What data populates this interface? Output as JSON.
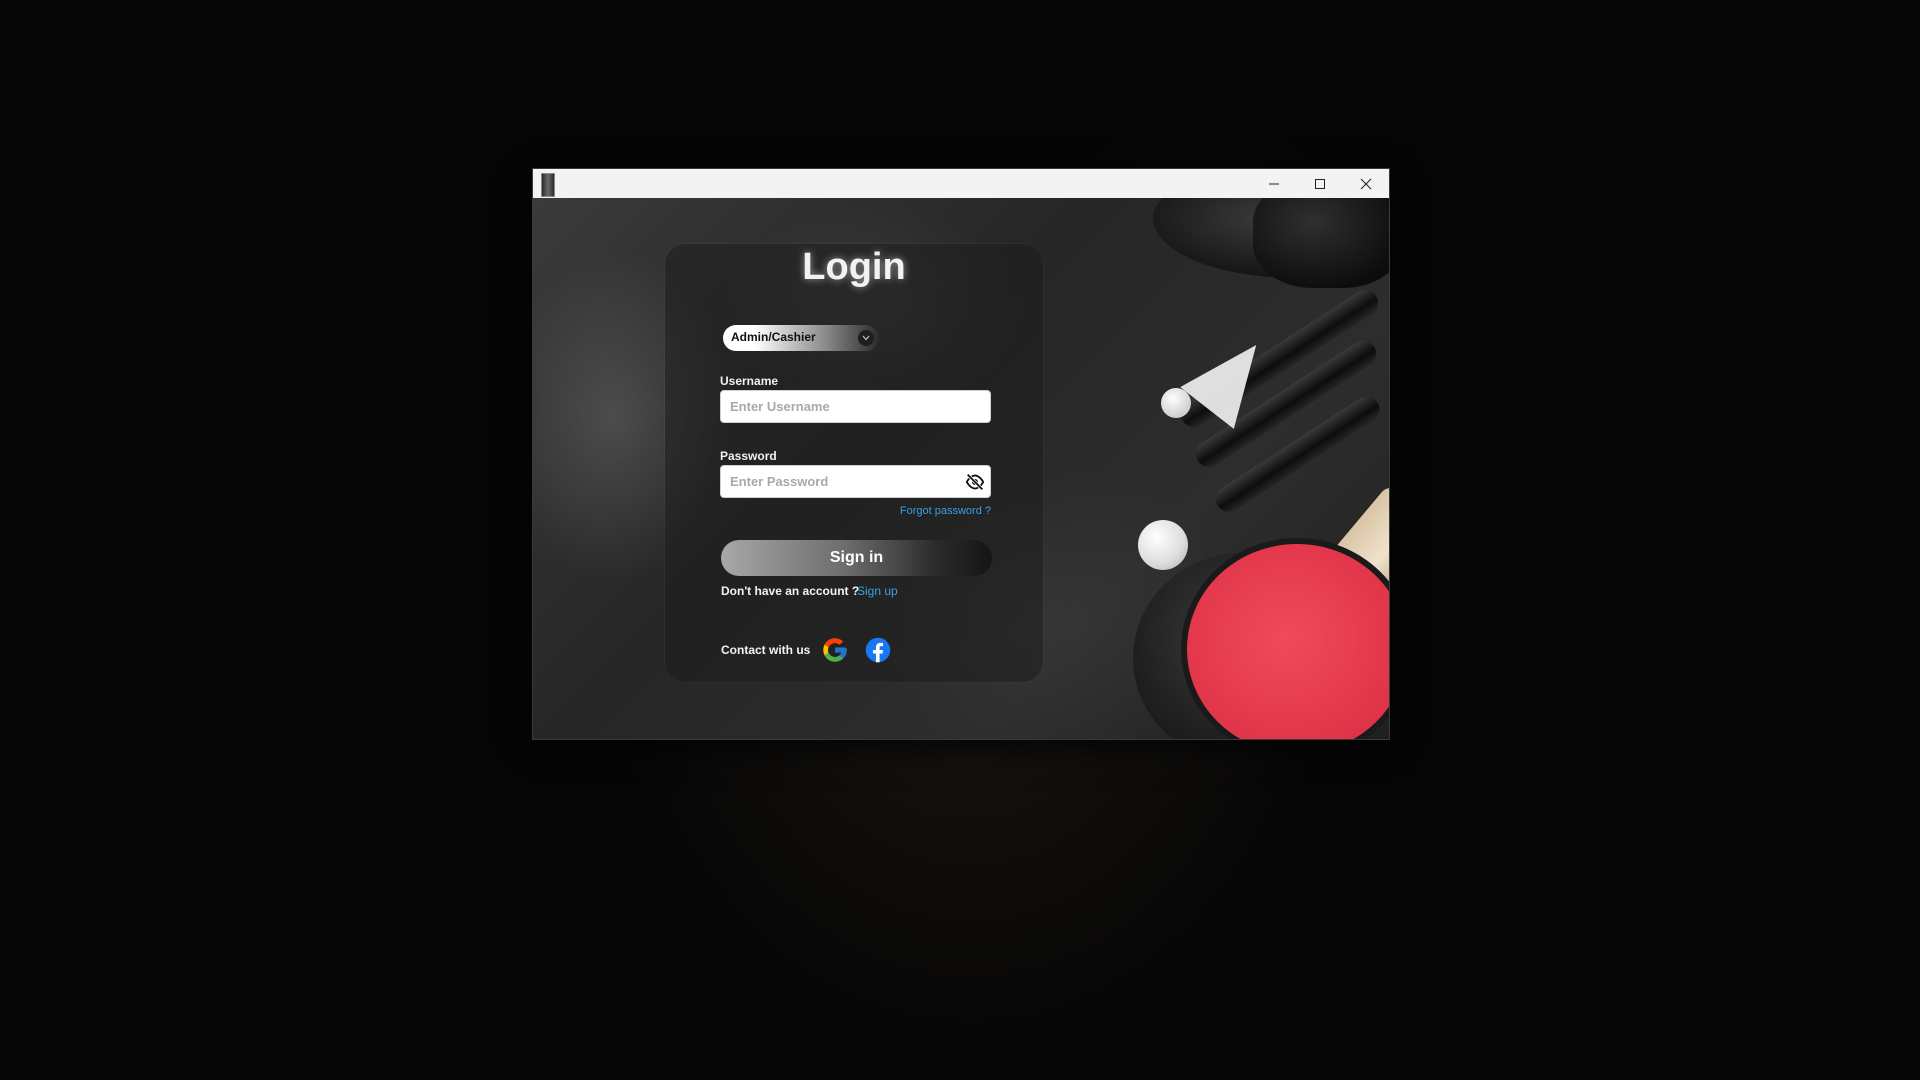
{
  "window": {
    "icon": "app-icon",
    "controls": {
      "minimize_icon": "minimize-icon",
      "maximize_icon": "maximize-icon",
      "close_icon": "close-icon"
    }
  },
  "login": {
    "title": "Login",
    "role_select": {
      "selected": "Admin/Cashier",
      "icon": "chevron-down-icon"
    },
    "username": {
      "label": "Username",
      "value": "",
      "placeholder": "Enter Username"
    },
    "password": {
      "label": "Password",
      "value": "",
      "placeholder": "Enter Password",
      "toggle_icon": "eye-slash-icon"
    },
    "forgot_password": "Forgot password ?",
    "sign_in": "Sign in",
    "no_account": "Don't have an account ?",
    "sign_up": "Sign up",
    "contact": {
      "label": "Contact with us",
      "icons": [
        "google-icon",
        "facebook-icon"
      ]
    }
  },
  "colors": {
    "link": "#3aa0e6",
    "title_glow": "#ffffff",
    "facebook": "#1877f2"
  }
}
